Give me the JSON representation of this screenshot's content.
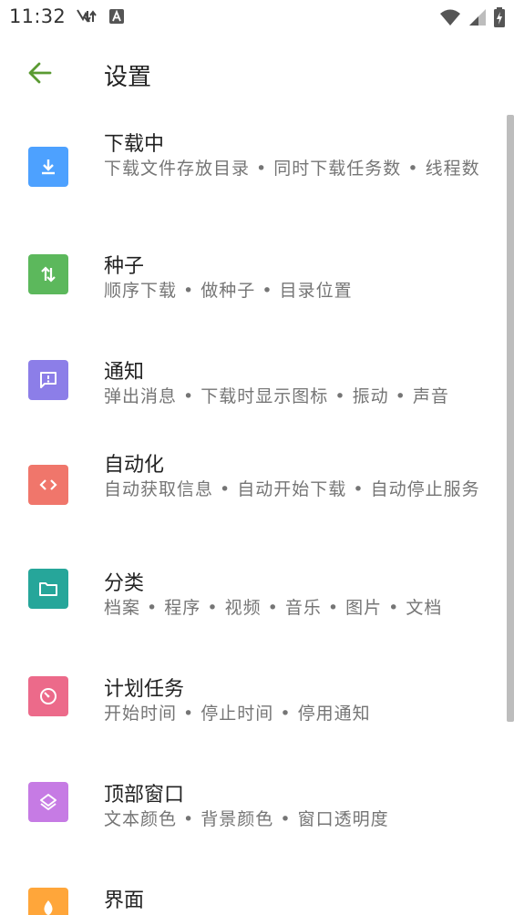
{
  "status_bar": {
    "time": "11:32"
  },
  "app_bar": {
    "title": "设置"
  },
  "items": [
    {
      "title": "下载中",
      "summary": "下载文件存放目录 • 同时下载任务数 • 线程数",
      "icon": "download-icon",
      "color": "#4da1ff"
    },
    {
      "title": "种子",
      "summary": "顺序下载 • 做种子 • 目录位置",
      "icon": "swap-vertical-icon",
      "color": "#5cb85c"
    },
    {
      "title": "通知",
      "summary": "弹出消息 • 下载时显示图标 • 振动 • 声音",
      "icon": "notification-message-icon",
      "color": "#8c7ee8"
    },
    {
      "title": "自动化",
      "summary": "自动获取信息 • 自动开始下载 • 自动停止服务",
      "icon": "code-icon",
      "color": "#f0766b"
    },
    {
      "title": "分类",
      "summary": "档案 • 程序 • 视频 • 音乐 • 图片 • 文档",
      "icon": "folder-icon",
      "color": "#26a69a"
    },
    {
      "title": "计划任务",
      "summary": "开始时间 • 停止时间 • 停用通知",
      "icon": "timer-icon",
      "color": "#ec6a8a"
    },
    {
      "title": "顶部窗口",
      "summary": "文本颜色 • 背景颜色 • 窗口透明度",
      "icon": "layers-icon",
      "color": "#c67be4"
    },
    {
      "title": "界面",
      "summary": "",
      "icon": "theme-icon",
      "color": "#ffa63a"
    }
  ],
  "colors": {
    "accent": "#5a9a32",
    "summary_text": "#757575"
  }
}
